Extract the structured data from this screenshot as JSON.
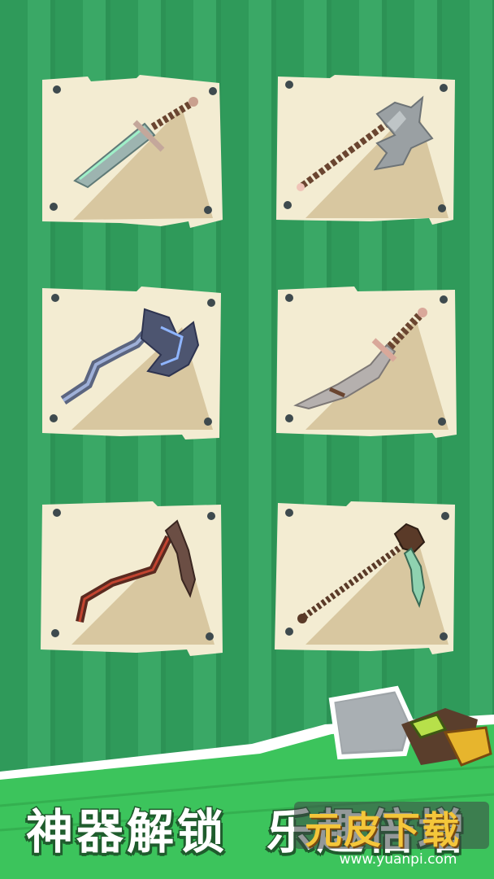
{
  "slogan": {
    "left": "神器解锁",
    "right": "乐趣倍增"
  },
  "watermark": {
    "logo": "元皮下载",
    "url": "www.yuanpi.com"
  },
  "weapons": [
    {
      "name": "sword-icon"
    },
    {
      "name": "battle-axe-icon"
    },
    {
      "name": "crystal-axe-icon"
    },
    {
      "name": "serrated-blade-icon"
    },
    {
      "name": "blood-scythe-icon"
    },
    {
      "name": "spiked-scythe-icon"
    }
  ],
  "colors": {
    "background": "#2f9a5a",
    "paper": "#f3ecd2",
    "shadow": "#d8c7a0",
    "pin": "#3e4a4e",
    "banner": "#3cc45c",
    "text_outline": "#1f5c2d"
  }
}
